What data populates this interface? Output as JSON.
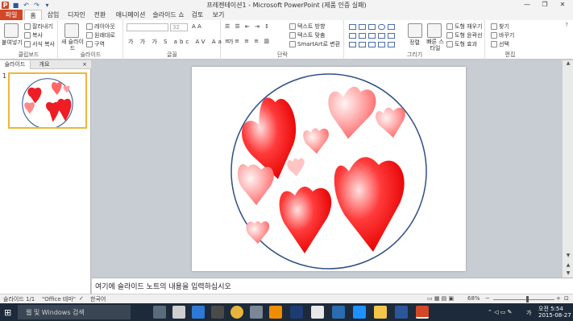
{
  "window": {
    "title": "프레젠테이션1 - Microsoft PowerPoint (제품 인증 실패)",
    "controls": [
      "—",
      "❐",
      "✕"
    ]
  },
  "tabs": [
    "파일",
    "홈",
    "삽입",
    "디자인",
    "전환",
    "애니메이션",
    "슬라이드 쇼",
    "검토",
    "보기"
  ],
  "ribbon": {
    "clipboard": {
      "paste": "붙여넣기",
      "cut": "잘라내기",
      "copy": "복사",
      "format_painter": "서식 복사",
      "label": "클립보드"
    },
    "slides": {
      "new_slide": "새 슬라이드",
      "layout": "레이아웃",
      "reset": "원래대로",
      "section": "구역",
      "label": "슬라이드"
    },
    "font": {
      "size": "32",
      "label": "글꼴"
    },
    "paragraph": {
      "text_direction": "텍스트 방향",
      "align_text": "텍스트 맞춤",
      "smartart": "SmartArt로 변환",
      "label": "단락"
    },
    "drawing": {
      "arrange": "정렬",
      "quick_styles": "빠른 스타일",
      "shape_fill": "도형 채우기",
      "shape_outline": "도형 윤곽선",
      "shape_effects": "도형 효과",
      "label": "그리기"
    },
    "editing": {
      "find": "찾기",
      "replace": "바꾸기",
      "select": "선택",
      "label": "편집"
    }
  },
  "left_pane": {
    "tabs": [
      "슬라이드",
      "개요"
    ],
    "close": "×",
    "slide_number": "1"
  },
  "notes_placeholder": "여기에 슬라이드 노트의 내용을 입력하십시오",
  "status": {
    "slide": "슬라이드 1/1",
    "theme": "\"Office 테마\"",
    "language": "한국어",
    "zoom": "68%",
    "zoom_fraction": 0.55
  },
  "taskbar": {
    "search": "웹 및 Windows 검색",
    "time": "오전 5:54",
    "date": "2015-08-27",
    "ime": "가"
  },
  "colors": {
    "file_tab": "#d24726",
    "heart": "#ee1c25",
    "circle": "#2f4f86",
    "thumb_border": "#f0b53a",
    "taskbar": "#1c2a3a"
  }
}
